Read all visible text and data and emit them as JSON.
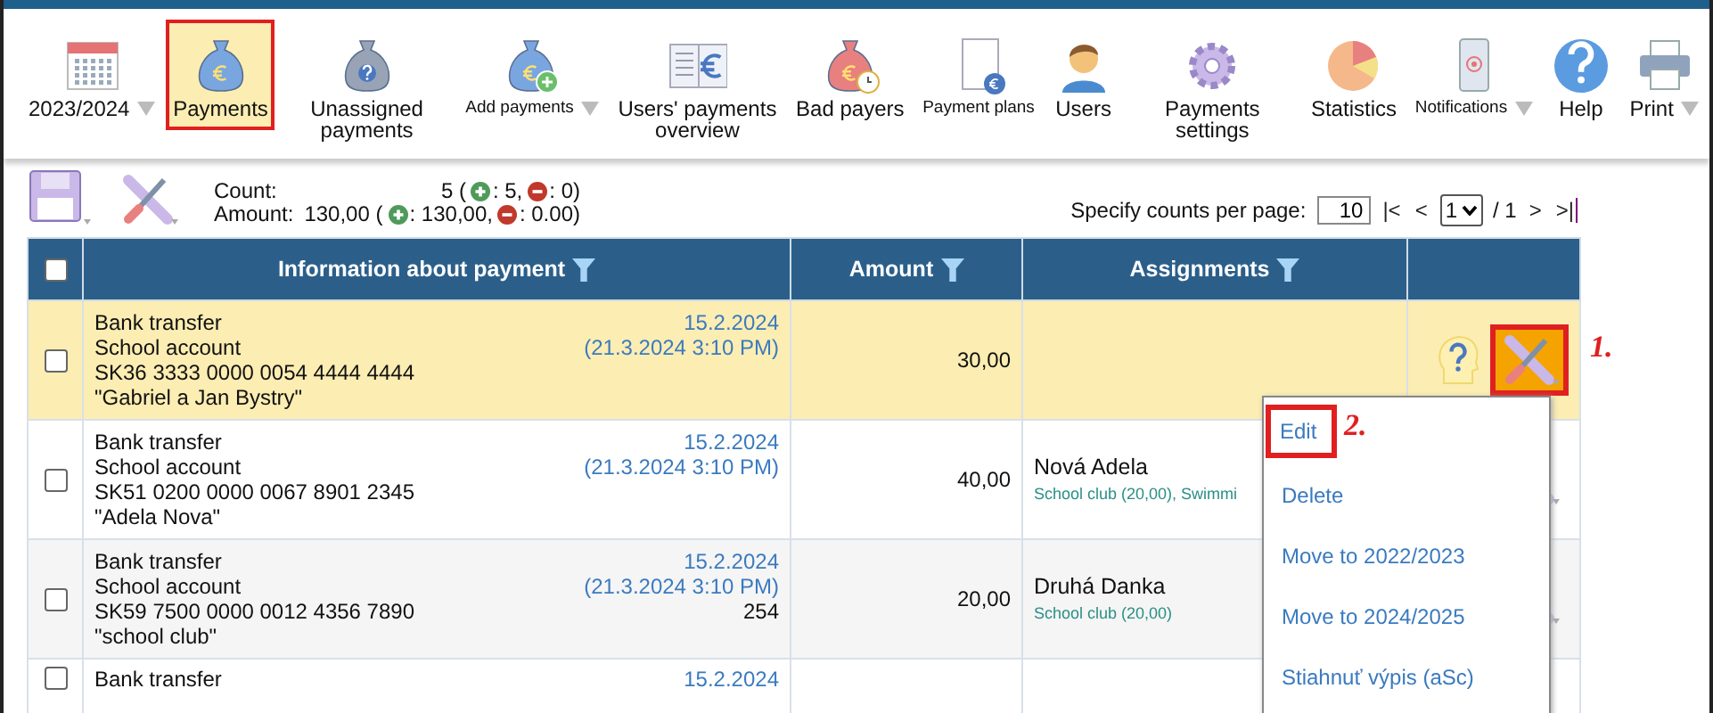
{
  "toolbar": [
    {
      "label": "2023/2024",
      "kind": "calendar",
      "dropdown": true,
      "selected": false,
      "small": false
    },
    {
      "label": "Payments",
      "kind": "bag-euro",
      "dropdown": false,
      "selected": true,
      "small": false
    },
    {
      "label": "Unassigned payments",
      "kind": "bag-question",
      "dropdown": false,
      "selected": false,
      "small": false
    },
    {
      "label": "Add payments",
      "kind": "bag-plus",
      "dropdown": true,
      "selected": false,
      "small": true
    },
    {
      "label": "Users' payments overview",
      "kind": "book",
      "dropdown": false,
      "selected": false,
      "small": false
    },
    {
      "label": "Bad payers",
      "kind": "bag-clock",
      "dropdown": false,
      "selected": false,
      "small": false
    },
    {
      "label": "Payment plans",
      "kind": "document",
      "dropdown": false,
      "selected": false,
      "small": true
    },
    {
      "label": "Users",
      "kind": "user",
      "dropdown": false,
      "selected": false,
      "small": false
    },
    {
      "label": "Payments settings",
      "kind": "gear",
      "dropdown": false,
      "selected": false,
      "small": false
    },
    {
      "label": "Statistics",
      "kind": "pie",
      "dropdown": false,
      "selected": false,
      "small": false
    },
    {
      "label": "Notifications",
      "kind": "phone",
      "dropdown": true,
      "selected": false,
      "small": true
    },
    {
      "label": "Help",
      "kind": "help",
      "dropdown": false,
      "selected": false,
      "small": false
    },
    {
      "label": "Print",
      "kind": "printer",
      "dropdown": true,
      "selected": false,
      "small": false
    }
  ],
  "summary": [
    {
      "label": "Count:",
      "total": "5 (",
      "plus": ": 5,",
      "minus": ": 0)"
    },
    {
      "label": "Amount:",
      "total": "130,00 (",
      "plus": ": 130,00,",
      "minus": ": 0.00)"
    }
  ],
  "pager": {
    "label": "Specify counts per page:",
    "per_page": "10",
    "first": "|<",
    "prev": "<",
    "page": "1",
    "of": "/ 1",
    "next": ">",
    "last": ">|"
  },
  "table": {
    "select_all_checked": false,
    "columns": [
      {
        "label": "Information about payment",
        "filter": true
      },
      {
        "label": "Amount",
        "filter": true
      },
      {
        "label": "Assignments",
        "filter": true
      }
    ],
    "rows": [
      {
        "highlighted": true,
        "checked": false,
        "lines": [
          "Bank transfer",
          "School account",
          "SK36 3333 0000 0054 4444 4444",
          "\"Gabriel a Jan Bystry\""
        ],
        "date": "15.2.2024",
        "posted": "(21.3.2024 3:10 PM)",
        "reference": "",
        "amount": "30,00",
        "assignee": "",
        "assignment_detail": "",
        "unassigned": true,
        "menu_open": true
      },
      {
        "highlighted": false,
        "checked": false,
        "lines": [
          "Bank transfer",
          "School account",
          "SK51 0200 0000 0067 8901 2345",
          "\"Adela Nova\""
        ],
        "date": "15.2.2024",
        "posted": "(21.3.2024 3:10 PM)",
        "reference": "",
        "amount": "40,00",
        "assignee": "Nová Adela",
        "assignment_detail": "School club (20,00), Swimmi",
        "menu_open": false
      },
      {
        "highlighted": false,
        "checked": false,
        "lines": [
          "Bank transfer",
          "School account",
          "SK59 7500 0000 0012 4356 7890",
          "\"school club\""
        ],
        "date": "15.2.2024",
        "posted": "(21.3.2024 3:10 PM)",
        "reference": "254",
        "amount": "20,00",
        "assignee": "Druhá Danka",
        "assignment_detail": "School club (20,00)",
        "menu_open": false
      },
      {
        "highlighted": false,
        "checked": false,
        "lines": [
          "Bank transfer"
        ],
        "date": "15.2.2024",
        "posted": "",
        "reference": "",
        "amount": "",
        "assignee": "",
        "assignment_detail": "",
        "menu_open": false
      }
    ]
  },
  "menu": {
    "items": [
      {
        "label": "Edit",
        "annotated": true
      },
      {
        "label": "Delete",
        "annotated": false
      },
      {
        "label": "Move to 2022/2023",
        "annotated": false
      },
      {
        "label": "Move to 2024/2025",
        "annotated": false
      },
      {
        "label": "Stiahnuť výpis (aSc)",
        "annotated": false
      }
    ]
  },
  "annotations": [
    "1.",
    "2."
  ]
}
